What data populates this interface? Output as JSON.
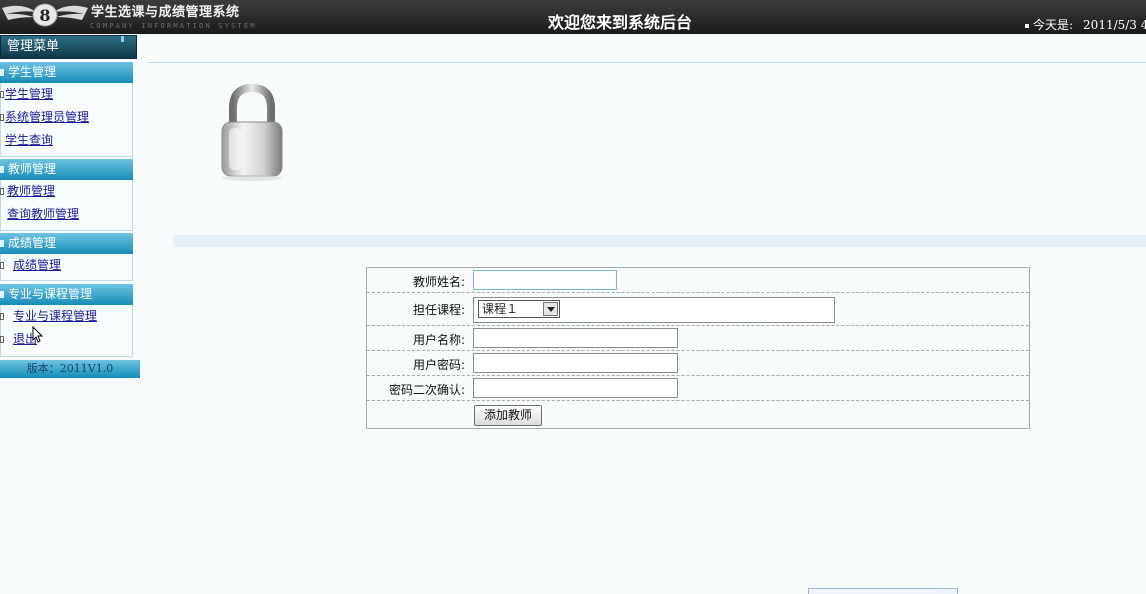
{
  "header": {
    "system_title": "学生选课与成绩管理系统",
    "system_subtitle": "COMPANY INFORMATION SYSTEM",
    "logo_text": "8",
    "welcome": "欢迎您来到系统后台",
    "today_label": "今天是:",
    "today_date": "2011/5/3 4:"
  },
  "sidebar": {
    "menu_title": "管理菜单",
    "groups": [
      {
        "title": "学生管理",
        "items": [
          "学生管理",
          "系统管理员管理",
          "学生查询"
        ]
      },
      {
        "title": "教师管理",
        "items": [
          "教师管理",
          "查询教师管理"
        ]
      },
      {
        "title": "成绩管理",
        "items": [
          "成绩管理"
        ]
      },
      {
        "title": "专业与课程管理",
        "items": [
          "专业与课程管理",
          "退出"
        ]
      }
    ],
    "version": "版本：2011V1.0"
  },
  "form": {
    "teacher_name_label": "教师姓名:",
    "teacher_name_value": "",
    "course_label": "担任课程:",
    "course_selected": "课程１",
    "username_label": "用户名称:",
    "username_value": "",
    "password_label": "用户密码:",
    "password_value": "",
    "confirm_label": "密码二次确认:",
    "confirm_value": "",
    "submit_label": "添加教师"
  },
  "colors": {
    "header_bg": "#1b1b1b",
    "sidebar_accent": "#158cb7",
    "link": "#1c1a9a",
    "page_bg": "#f7fbfb"
  },
  "icons": {
    "logo": "winged-logo-icon",
    "lock": "padlock-icon",
    "cursor": "mouse-cursor-icon"
  }
}
